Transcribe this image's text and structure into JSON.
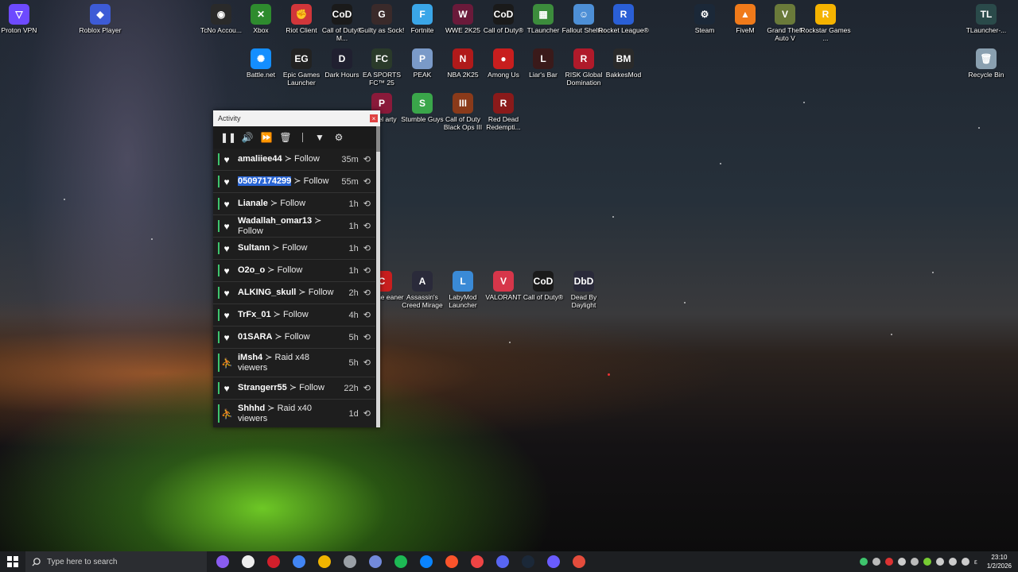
{
  "desktop": {
    "icons": [
      {
        "label": "Proton VPN",
        "color": "#6d4aff",
        "glyph": "▽"
      },
      {
        "label": "Roblox Player",
        "color": "#3d5bd6",
        "glyph": "◆"
      },
      {
        "label": "TcNo Accou...",
        "color": "#2a2a2a",
        "glyph": "◉"
      },
      {
        "label": "Xbox",
        "color": "#2e8b2e",
        "glyph": "✕"
      },
      {
        "label": "Riot Client",
        "color": "#d1363a",
        "glyph": "✊"
      },
      {
        "label": "Call of Duty® M...",
        "color": "#1a1a1a",
        "glyph": "CoD"
      },
      {
        "label": "Guilty as Sock!",
        "color": "#3a2a2a",
        "glyph": "G"
      },
      {
        "label": "Fortnite",
        "color": "#3aa6e8",
        "glyph": "F"
      },
      {
        "label": "WWE 2K25",
        "color": "#6a1a3a",
        "glyph": "W"
      },
      {
        "label": "Call of Duty®",
        "color": "#1a1a1a",
        "glyph": "CoD"
      },
      {
        "label": "TLauncher",
        "color": "#3c8c3c",
        "glyph": "▦"
      },
      {
        "label": "Fallout Shelter",
        "color": "#4d8fd6",
        "glyph": "☺"
      },
      {
        "label": "Rocket League®",
        "color": "#2a5fd6",
        "glyph": "R"
      },
      {
        "label": "Steam",
        "color": "#1b2838",
        "glyph": "⚙"
      },
      {
        "label": "FiveM",
        "color": "#f07a1a",
        "glyph": "▲"
      },
      {
        "label": "Grand Theft Auto V",
        "color": "#6a7a3a",
        "glyph": "V"
      },
      {
        "label": "Rockstar Games ...",
        "color": "#f5b300",
        "glyph": "R"
      },
      {
        "label": "TLauncher-...",
        "color": "#2a4a4a",
        "glyph": "TL"
      },
      {
        "label": "Battle.net",
        "color": "#148eff",
        "glyph": "✺"
      },
      {
        "label": "Epic Games Launcher",
        "color": "#222",
        "glyph": "EG"
      },
      {
        "label": "Dark Hours",
        "color": "#202030",
        "glyph": "D"
      },
      {
        "label": "EA SPORTS FC™ 25",
        "color": "#2a3a2a",
        "glyph": "FC"
      },
      {
        "label": "PEAK",
        "color": "#7a9ac8",
        "glyph": "P"
      },
      {
        "label": "NBA 2K25",
        "color": "#b01a1a",
        "glyph": "N"
      },
      {
        "label": "Among Us",
        "color": "#c81e1e",
        "glyph": "●"
      },
      {
        "label": "Liar's Bar",
        "color": "#3a1a1a",
        "glyph": "L"
      },
      {
        "label": "RISK Global Domination",
        "color": "#b01a2a",
        "glyph": "R"
      },
      {
        "label": "BakkesMod",
        "color": "#2a2a2a",
        "glyph": "BM"
      },
      {
        "label": "Recycle Bin",
        "color": "#8aa0b0",
        "glyph": "🗑"
      },
      {
        "label": "Stumble Guys",
        "color": "#3aa64a",
        "glyph": "S"
      },
      {
        "label": "Call of Duty Black Ops III",
        "color": "#8a3a1a",
        "glyph": "III"
      },
      {
        "label": "Red Dead Redempti...",
        "color": "#8a1a1a",
        "glyph": "R"
      },
      {
        "label": "Assassin's Creed Mirage",
        "color": "#2a2a3a",
        "glyph": "A"
      },
      {
        "label": "LabyMod Launcher",
        "color": "#3a8ad6",
        "glyph": "L"
      },
      {
        "label": "VALORANT",
        "color": "#d6364a",
        "glyph": "V"
      },
      {
        "label": "Call of Duty®",
        "color": "#1a1a1a",
        "glyph": "CoD"
      },
      {
        "label": "Dead By Daylight",
        "color": "#2a2a3a",
        "glyph": "DbD"
      },
      {
        "label": "mmel arty",
        "color": "#8a1a3a",
        "glyph": "P"
      },
      {
        "label": "e Scene eaner",
        "color": "#c81e1e",
        "glyph": "C"
      }
    ]
  },
  "activity": {
    "title": "Activity",
    "close_glyph": "×",
    "toolbar": {
      "pause": "❚❚",
      "volume": "🔊",
      "skip": "⏩",
      "trash": "🗑",
      "filter": "▼",
      "settings": "⚙"
    },
    "events": [
      {
        "user": "amaliiee44",
        "action": "Follow",
        "time": "35m",
        "type": "follow",
        "selected": false
      },
      {
        "user": "05097174299",
        "action": "Follow",
        "time": "55m",
        "type": "follow",
        "selected": true
      },
      {
        "user": "Lianale",
        "action": "Follow",
        "time": "1h",
        "type": "follow",
        "selected": false
      },
      {
        "user": "Wadallah_omar13",
        "action": "Follow",
        "time": "1h",
        "type": "follow",
        "selected": false
      },
      {
        "user": "Sultann",
        "action": "Follow",
        "time": "1h",
        "type": "follow",
        "selected": false
      },
      {
        "user": "O2o_o",
        "action": "Follow",
        "time": "1h",
        "type": "follow",
        "selected": false
      },
      {
        "user": "ALKING_skull",
        "action": "Follow",
        "time": "2h",
        "type": "follow",
        "selected": false
      },
      {
        "user": "TrFx_01",
        "action": "Follow",
        "time": "4h",
        "type": "follow",
        "selected": false
      },
      {
        "user": "01SARA",
        "action": "Follow",
        "time": "5h",
        "type": "follow",
        "selected": false
      },
      {
        "user": "iMsh4",
        "action": "Raid x48 viewers",
        "time": "5h",
        "type": "raid",
        "selected": false
      },
      {
        "user": "Strangerr55",
        "action": "Follow",
        "time": "22h",
        "type": "follow",
        "selected": false
      },
      {
        "user": "Shhhd",
        "action": "Raid x40 viewers",
        "time": "1d",
        "type": "raid",
        "selected": false
      }
    ],
    "separator": " ≻ ",
    "repeat_glyph": "⟲"
  },
  "taskbar": {
    "search_placeholder": "Type here to search",
    "apps": [
      "#8a5cf0",
      "#eeeeee",
      "#d21f2b",
      "#4285f4",
      "#f0b400",
      "#9aa0a6",
      "#7289da",
      "#1db954",
      "#0a84ff",
      "#fb542b",
      "#e44",
      "#5865f2",
      "#1b2838",
      "#6a5cff",
      "#e44c3c"
    ],
    "clock_time": "23:10",
    "clock_date": "1/2/2026",
    "lang": "ε"
  }
}
